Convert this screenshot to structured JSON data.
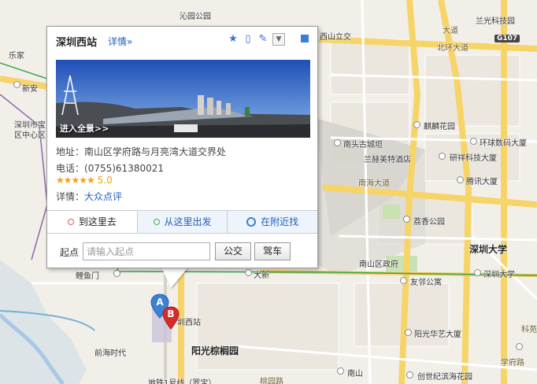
{
  "popup": {
    "title": "深圳西站",
    "detail_link": "详情»",
    "icons": [
      "star-icon",
      "phone-icon",
      "edit-icon",
      "dropdown-icon",
      "close-icon"
    ],
    "photo_caption": "进入全景>>",
    "address_label": "地址：",
    "address": "南山区学府路与月亮湾大道交界处",
    "phone_label": "电话：",
    "phone": "(0755)61380021",
    "stars": "★★★★★",
    "rating": "5.0",
    "details_label": "详情：",
    "details_link": "大众点评",
    "tabs": [
      {
        "label": "到这里去",
        "dot_color": "#e05a5a"
      },
      {
        "label": "从这里出发",
        "dot_color": "#4cae4c"
      },
      {
        "label": "在附近找",
        "icon": "search-icon"
      }
    ],
    "start_label": "起点",
    "start_placeholder": "请输入起点",
    "start_value": "",
    "bus_button": "公交",
    "car_button": "驾车"
  },
  "map": {
    "labels": {
      "lichun": "沁园公园",
      "lejia": "乐家",
      "xinan": "新安",
      "szgov": "深圳市宝",
      "szgov2": "区中心区",
      "xishan": "西山立交",
      "beihuan": "北环大道",
      "lanhua": "兰光科技园",
      "g107": "G107",
      "qilin": "麒麟花园",
      "nantou": "南头古城垣",
      "huanqiu": "环球数码大厦",
      "hotel": "兰赫美特酒店",
      "yanxiang": "研祥科技大厦",
      "tengxun": "腾讯大厦",
      "nanhai": "南海大道",
      "lixiang": "荔香公园",
      "szu": "深圳大学",
      "szu2": "深圳大学",
      "gov": "南山区政府",
      "youlin": "友邻公寓",
      "lijiang": "鲤鱼门",
      "daxin": "大新",
      "station": "圳西站",
      "yangguang": "阳光棕榈园",
      "huayi": "阳光华艺大厦",
      "qianhai": "前海时代",
      "nanshan": "南山",
      "chuangshi": "创世纪滨海花园",
      "xuefu": "学府路",
      "keji": "科苑",
      "line1": "地铁1号线（罗宝）",
      "taoyuan": "桃园路",
      "dadao": "大道"
    },
    "marker_a": "A",
    "marker_b": "B"
  }
}
